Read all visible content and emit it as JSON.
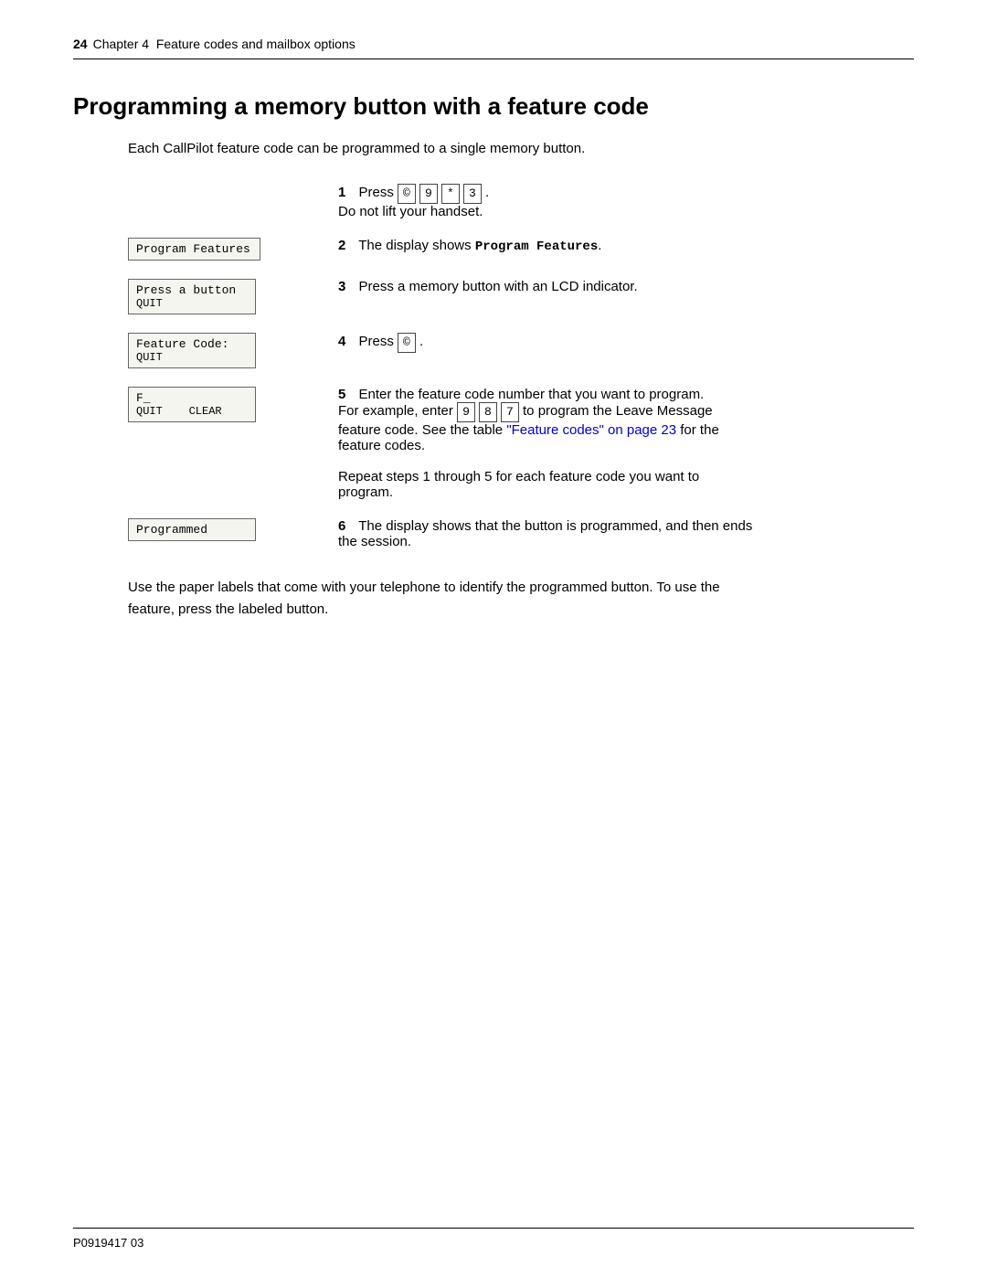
{
  "header": {
    "page_num": "24",
    "chapter_label": "Chapter 4",
    "chapter_title": "Feature codes and mailbox options"
  },
  "section": {
    "title": "Programming a memory button with a feature code"
  },
  "intro": "Each CallPilot feature code can be programmed to a single memory button.",
  "steps": [
    {
      "num": "1",
      "lcd": null,
      "text": "Press",
      "keys": [
        "©",
        "9",
        "*",
        "3"
      ],
      "text_after": ".\nDo not lift your handset.",
      "link": null
    },
    {
      "num": "2",
      "lcd": {
        "line1": "Program Features",
        "line2": null
      },
      "text_before": "The display shows ",
      "mono": "Program Features",
      "text_after": ".",
      "link": null
    },
    {
      "num": "3",
      "lcd": {
        "line1": "Press a button",
        "line2": "QUIT"
      },
      "text": "Press a memory button with an LCD indicator.",
      "link": null
    },
    {
      "num": "4",
      "lcd": {
        "line1": "Feature Code:",
        "line2": "QUIT"
      },
      "text": "Press",
      "keys": [
        "©"
      ],
      "text_after": ".",
      "link": null
    },
    {
      "num": "5",
      "lcd": {
        "line1": "F_",
        "line2": "QUIT    CLEAR"
      },
      "text_before": "Enter the feature code number that you want to program.\nFor example, enter ",
      "example_keys": [
        "9",
        "8",
        "7"
      ],
      "text_after": " to program the Leave Message\nfeature code. See the table ",
      "link_text": "\"Feature codes\" on page 23",
      "text_end": " for the\nfeature codes.",
      "repeat_text": "Repeat steps 1 through 5 for each feature code you want to\nprogram.",
      "link": null
    },
    {
      "num": "6",
      "lcd": {
        "line1": "Programmed",
        "line2": null
      },
      "text": "The display shows that the button is programmed, and then ends\nthe session.",
      "link": null
    }
  ],
  "footer_para": "Use the paper labels that come with your telephone to identify the programmed button. To use the\nfeature, press the labeled button.",
  "footer": {
    "doc_num": "P0919417 03"
  }
}
